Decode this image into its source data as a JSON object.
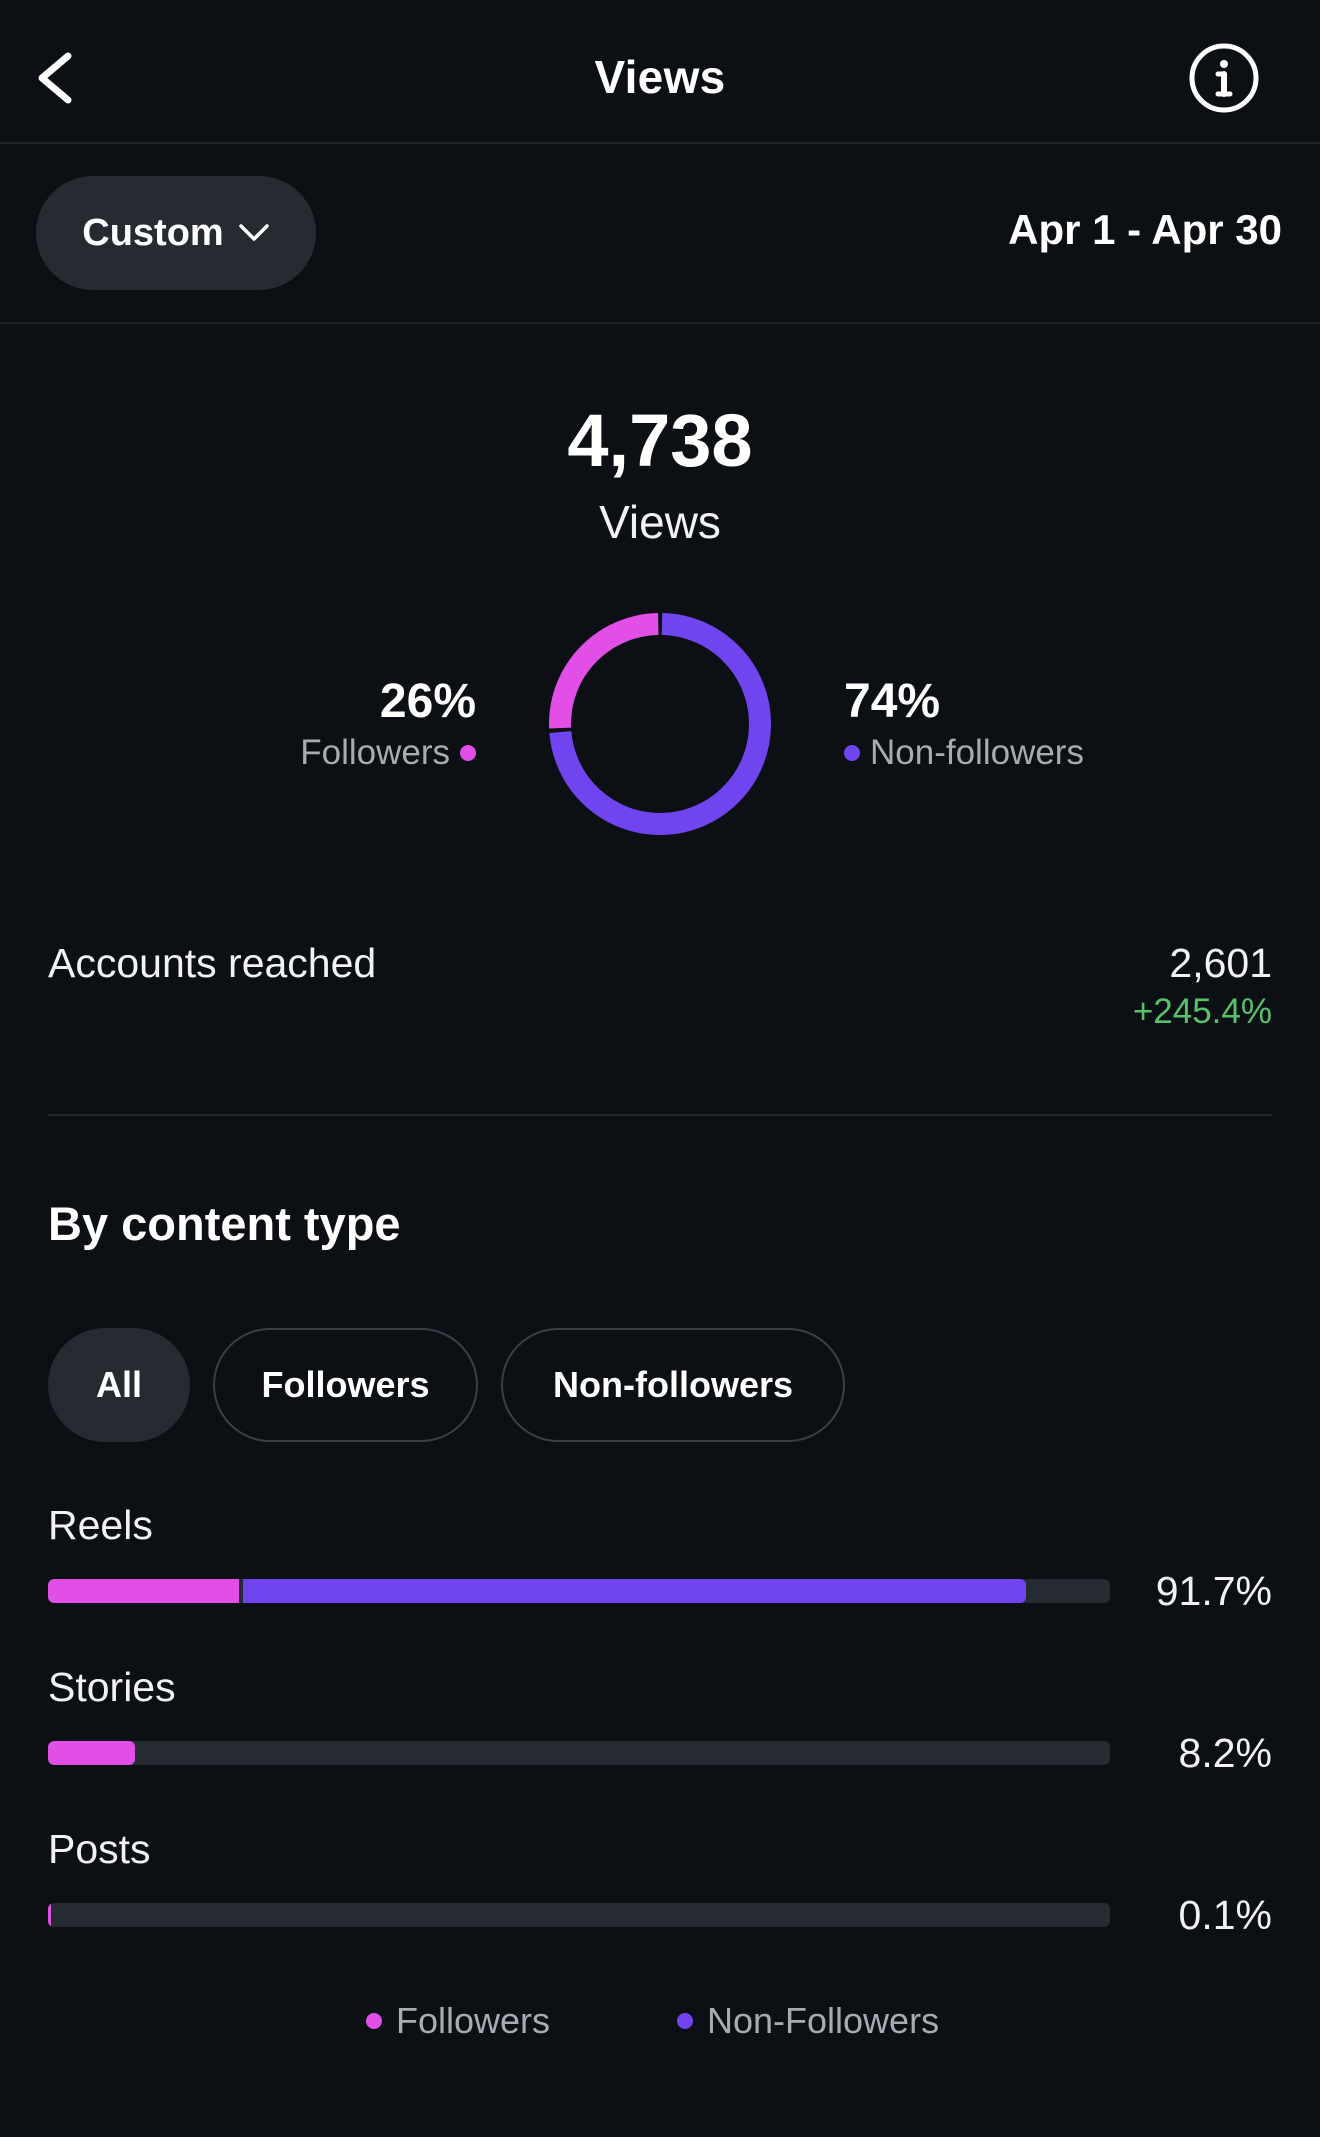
{
  "header": {
    "title": "Views",
    "back_icon": "chevron-left-icon",
    "info_icon": "info-circle-icon"
  },
  "filter": {
    "range_label": "Custom",
    "dropdown_icon": "chevron-down-icon",
    "date_range": "Apr 1 - Apr 30"
  },
  "summary": {
    "total": "4,738",
    "total_label": "Views",
    "followers_pct": "26%",
    "followers_label": "Followers",
    "non_followers_pct": "74%",
    "non_followers_label": "Non-followers",
    "donut": {
      "followers_fraction": 0.26,
      "non_followers_fraction": 0.74
    }
  },
  "accounts_reached": {
    "label": "Accounts reached",
    "value": "2,601",
    "change": "+245.4%"
  },
  "content_type": {
    "title": "By content type",
    "filters": [
      {
        "label": "All",
        "active": true
      },
      {
        "label": "Followers",
        "active": false
      },
      {
        "label": "Non-followers",
        "active": false
      }
    ],
    "rows": [
      {
        "label": "Reels",
        "percent": "91.7%",
        "followers_fraction": 0.18,
        "non_followers_fraction": 0.737
      },
      {
        "label": "Stories",
        "percent": "8.2%",
        "followers_fraction": 0.082,
        "non_followers_fraction": 0.0
      },
      {
        "label": "Posts",
        "percent": "0.1%",
        "followers_fraction": 0.001,
        "non_followers_fraction": 0.0
      }
    ],
    "legend": {
      "followers": "Followers",
      "non_followers": "Non-Followers"
    }
  },
  "colors": {
    "background": "#0c0f14",
    "followers": "#e14fe6",
    "non_followers": "#7045f0",
    "positive_change": "#58c26b",
    "muted_text": "#a7abb2",
    "pill_background": "#262a31"
  }
}
